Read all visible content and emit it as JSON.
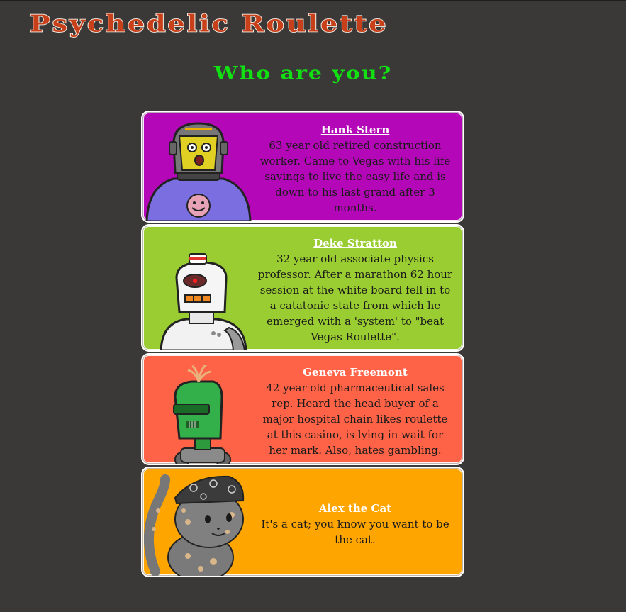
{
  "page": {
    "title": "Psychedelic Roulette",
    "subtitle": "Who are you?"
  },
  "characters": [
    {
      "name": "Hank Stern",
      "description": "63 year old retired construction worker. Came to Vegas with his life savings to live the easy life and is down to his last grand after 3 months.",
      "color": "#b408b8"
    },
    {
      "name": "Deke Stratton",
      "description": "32 year old associate physics professor. After a marathon 62 hour session at the white board fell in to a catatonic state from which he emerged with a 'system' to \"beat Vegas Roulette\".",
      "color": "#9acd32"
    },
    {
      "name": "Geneva Freemont",
      "description": "42 year old pharmaceutical sales rep. Heard the head buyer of a major hospital chain likes roulette at this casino, is lying in wait for her mark. Also, hates gambling.",
      "color": "#ff6347"
    },
    {
      "name": "Alex the Cat",
      "description": "It's a cat; you know you want to be the cat.",
      "color": "#ffa500"
    }
  ],
  "colors": {
    "background": "#3a3938",
    "title": "#c8401a",
    "subtitle": "#12e012"
  }
}
